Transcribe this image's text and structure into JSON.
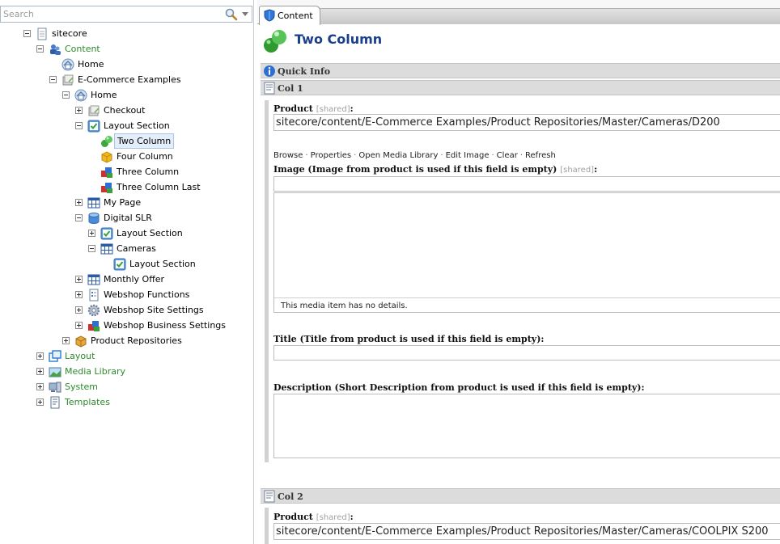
{
  "search": {
    "placeholder": "Search"
  },
  "tree": {
    "sitecore": "sitecore",
    "content": "Content",
    "home": "Home",
    "ecommerce": "E-Commerce Examples",
    "ec_home": "Home",
    "checkout": "Checkout",
    "layout_section": "Layout Section",
    "two_column": "Two Column",
    "four_column": "Four Column",
    "three_column": "Three Column",
    "three_column_last": "Three Column Last",
    "my_page": "My Page",
    "digital_slr": "Digital SLR",
    "dslr_layout_section": "Layout Section",
    "cameras": "Cameras",
    "cameras_layout_section": "Layout Section",
    "monthly_offer": "Monthly Offer",
    "webshop_functions": "Webshop Functions",
    "webshop_site_settings": "Webshop Site Settings",
    "webshop_business_settings": "Webshop Business Settings",
    "product_repositories": "Product Repositories",
    "layout": "Layout",
    "media_library": "Media Library",
    "system": "System",
    "templates": "Templates"
  },
  "tab": {
    "label": "Content"
  },
  "item": {
    "title": "Two Column"
  },
  "sections": {
    "quick_info": "Quick Info",
    "col1": "Col 1",
    "col2": "Col 2"
  },
  "fields": {
    "product_label": "Product",
    "shared_tag": "[shared]",
    "colon": ":",
    "col1_product_value": "sitecore/content/E-Commerce Examples/Product Repositories/Master/Cameras/D200",
    "image_label": "Image (Image from product is used if this field is empty)",
    "title_label": "Title (Title from product is used if this field is empty):",
    "description_label": "Description (Short Description from product is used if this field is empty):",
    "no_details": "This media item has no details.",
    "col2_product_value": "sitecore/content/E-Commerce Examples/Product Repositories/Master/Cameras/COOLPIX S200"
  },
  "image_commands": {
    "browse": "Browse",
    "properties": "Properties",
    "open_media_library": "Open Media Library",
    "edit_image": "Edit Image",
    "clear": "Clear",
    "refresh": "Refresh",
    "separator": "·"
  },
  "icons": {
    "search": "search-icon",
    "item_two_column": "green-sphere-icon",
    "content_tab": "blue-shield-icon"
  }
}
